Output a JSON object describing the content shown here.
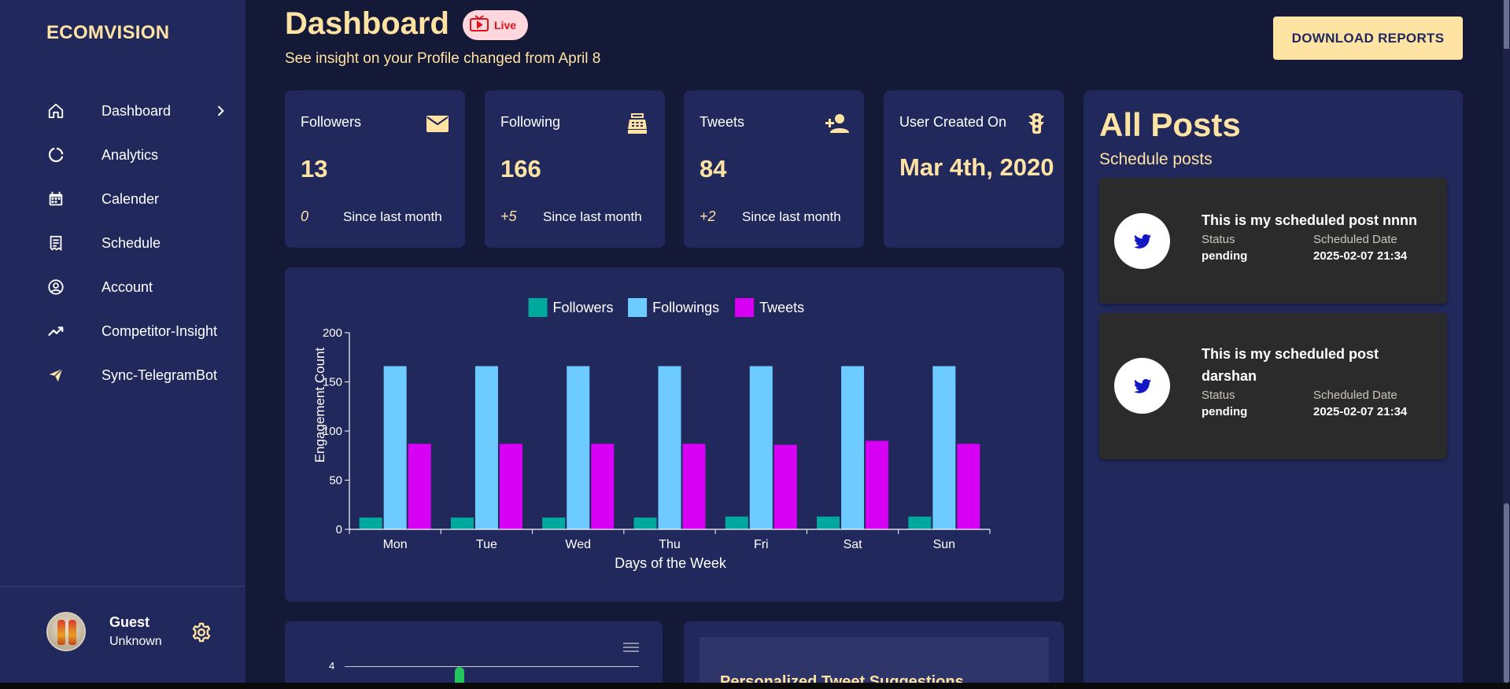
{
  "sidebar": {
    "brand": "ECOMVISION",
    "items": [
      {
        "label": "Dashboard",
        "icon": "home-icon"
      },
      {
        "label": "Analytics",
        "icon": "analytics-icon"
      },
      {
        "label": "Calender",
        "icon": "calendar-icon"
      },
      {
        "label": "Schedule",
        "icon": "receipt-icon"
      },
      {
        "label": "Account",
        "icon": "account-icon"
      },
      {
        "label": "Competitor-Insight",
        "icon": "trending-up-icon"
      },
      {
        "label": "Sync-TelegramBot",
        "icon": "send-icon"
      }
    ],
    "user": {
      "name": "Guest",
      "role": "Unknown"
    }
  },
  "header": {
    "title": "Dashboard",
    "live_label": "Live",
    "subtitle": "See insight on your Profile changed from April 8",
    "download_label": "DOWNLOAD REPORTS"
  },
  "stats": [
    {
      "label": "Followers",
      "value": "13",
      "delta": "0",
      "since": "Since last month",
      "icon": "mail-icon"
    },
    {
      "label": "Following",
      "value": "166",
      "delta": "+5",
      "since": "Since last month",
      "icon": "point-of-sale-icon"
    },
    {
      "label": "Tweets",
      "value": "84",
      "delta": "+2",
      "since": "Since last month",
      "icon": "person-add-icon"
    },
    {
      "label": "User Created On",
      "value": "Mar 4th, 2020",
      "icon": "traffic-icon"
    }
  ],
  "chart_data": {
    "type": "bar",
    "categories": [
      "Mon",
      "Tue",
      "Wed",
      "Thu",
      "Fri",
      "Sat",
      "Sun"
    ],
    "series": [
      {
        "name": "Followers",
        "color": "#00a99d",
        "values": [
          12,
          12,
          12,
          12,
          13,
          13,
          13
        ]
      },
      {
        "name": "Followings",
        "color": "#6ecbff",
        "values": [
          166,
          166,
          166,
          166,
          166,
          166,
          166
        ]
      },
      {
        "name": "Tweets",
        "color": "#d700f5",
        "values": [
          87,
          87,
          87,
          87,
          86,
          90,
          87
        ]
      }
    ],
    "xlabel": "Days of the Week",
    "ylabel": "Engagement Count",
    "ylim": [
      0,
      200
    ],
    "yticks": [
      0,
      50,
      100,
      150,
      200
    ],
    "legend": "top-center",
    "grid": false
  },
  "posts": {
    "title": "All Posts",
    "subtitle": "Schedule posts",
    "status_label": "Status",
    "date_label": "Scheduled Date",
    "items": [
      {
        "title": "This is my scheduled post nnnn",
        "status": "pending",
        "date": "2025-02-07 21:34"
      },
      {
        "title": "This is my scheduled post darshan",
        "status": "pending",
        "date": "2025-02-07 21:34"
      }
    ]
  },
  "mini_chart": {
    "y_tick": "4",
    "menu_icon": "hamburger-menu-icon"
  },
  "suggestions": {
    "title": "Personalized Tweet Suggestions"
  },
  "colors": {
    "accent": "#ffe3a3",
    "panel": "#21295c",
    "background": "#141937",
    "live_red": "#e0111b"
  }
}
